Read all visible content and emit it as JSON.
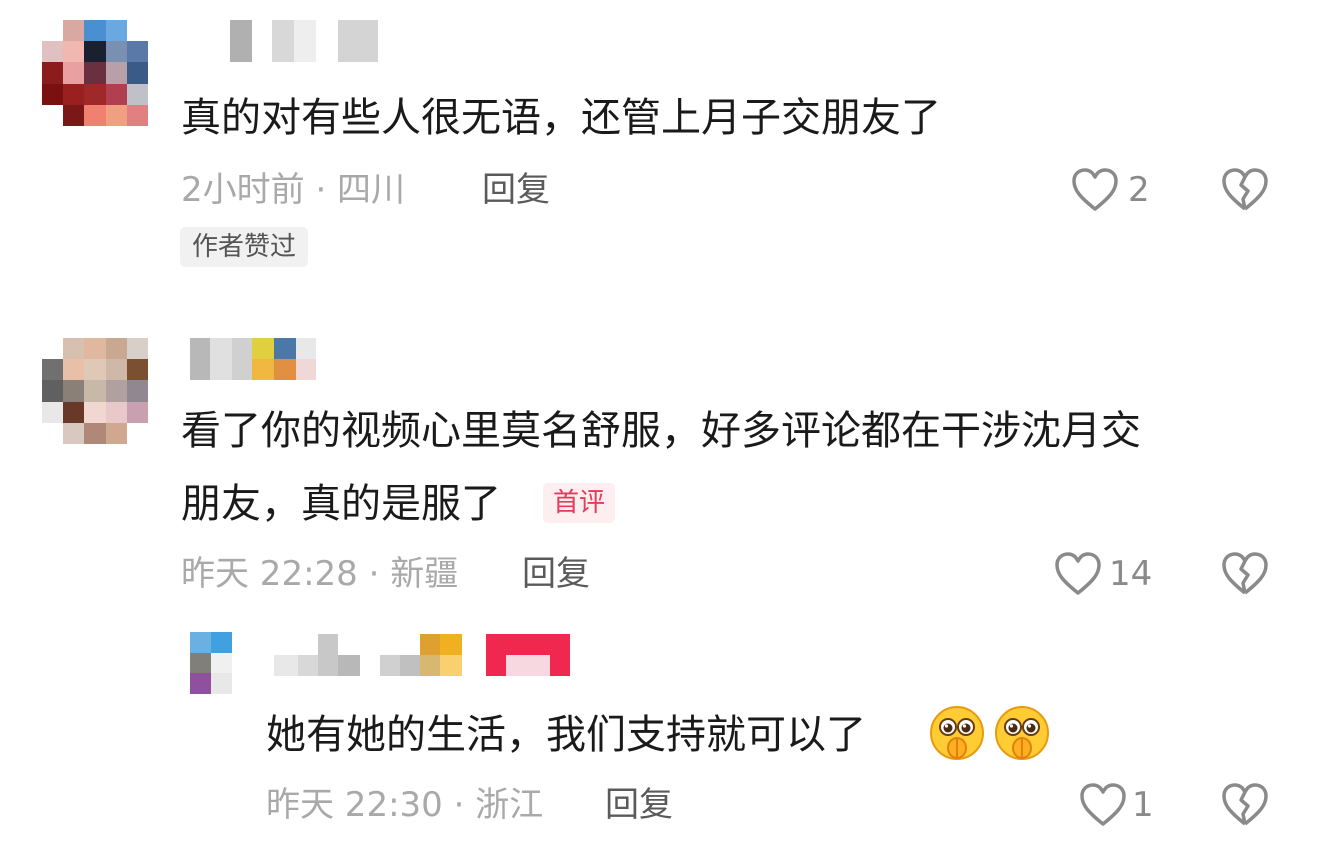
{
  "comments": [
    {
      "text": "真的对有些人很无语，还管上月子交朋友了",
      "meta": "2小时前 · 四川",
      "reply_label": "回复",
      "like_count": "2",
      "tag": "作者赞过"
    },
    {
      "text_line1": "看了你的视频心里莫名舒服，好多评论都在干涉沈月交",
      "text_line2": "朋友，真的是服了",
      "tag": "首评",
      "meta": "昨天 22:28 · 新疆",
      "reply_label": "回复",
      "like_count": "14",
      "replies": [
        {
          "text": "她有她的生活，我们支持就可以了",
          "meta": "昨天 22:30 · 浙江",
          "reply_label": "回复",
          "like_count": "1",
          "emojis": [
            "pleading-hands-emoji",
            "pleading-hands-emoji"
          ]
        }
      ]
    }
  ],
  "icons": {
    "like": "heart-outline-icon",
    "dislike": "broken-heart-icon"
  },
  "colors": {
    "text": "#1a1a1a",
    "meta": "#a9a9a9",
    "first_comment_tag": "#e33b5a",
    "first_comment_tag_bg": "#fdeef0",
    "author_tag_bg": "#f1f1f1"
  }
}
